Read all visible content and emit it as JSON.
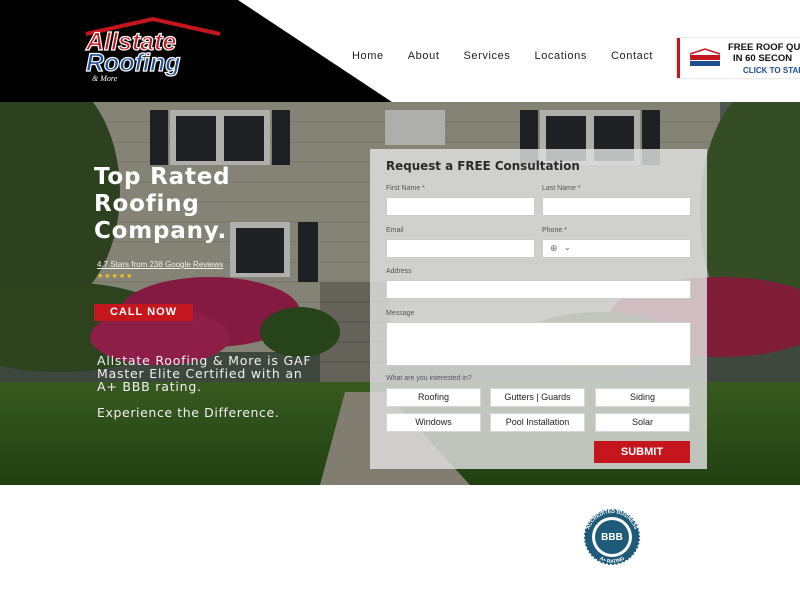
{
  "header": {
    "logo_text_1": "Allstate",
    "logo_text_2": "Roofing",
    "logo_text_3": "& More",
    "nav": [
      "Home",
      "About",
      "Services",
      "Locations",
      "Contact"
    ],
    "quote": {
      "line1": "FREE ROOF QU",
      "line2": "IN 60 SECON",
      "line3": "CLICK TO STAR"
    }
  },
  "hero": {
    "headline": [
      "Top Rated",
      "Roofing",
      "Company."
    ],
    "reviews": "4.7 Stars from 238 Google Reviews",
    "stars": "★★★★★",
    "call_label": "CALL NOW",
    "tagline": "Allstate Roofing & More is GAF Master Elite Certified with an A+ BBB rating.",
    "tagline2": "Experience the Difference."
  },
  "form": {
    "title": "Request a FREE Consultation",
    "first_name_label": "First Name *",
    "last_name_label": "Last Name *",
    "email_label": "Email",
    "phone_label": "Phone *",
    "address_label": "Address",
    "message_label": "Message",
    "interest_label": "What are you interested in?",
    "options": [
      "Roofing",
      "Gutters | Guards",
      "Siding",
      "Windows",
      "Pool Installation",
      "Solar"
    ],
    "submit_label": "SUBMIT"
  },
  "bbb": {
    "top_text": "ACCREDITED BUSINESS",
    "center": "BBB",
    "bottom": "A+ RATING"
  },
  "colors": {
    "accent": "#c4161c",
    "logo_blue": "#1d4e8f",
    "bbb_blue": "#1e5b7a"
  },
  "icons": {
    "phone_flag": "globe-flag-icon",
    "dropdown": "chevron-down-icon"
  }
}
